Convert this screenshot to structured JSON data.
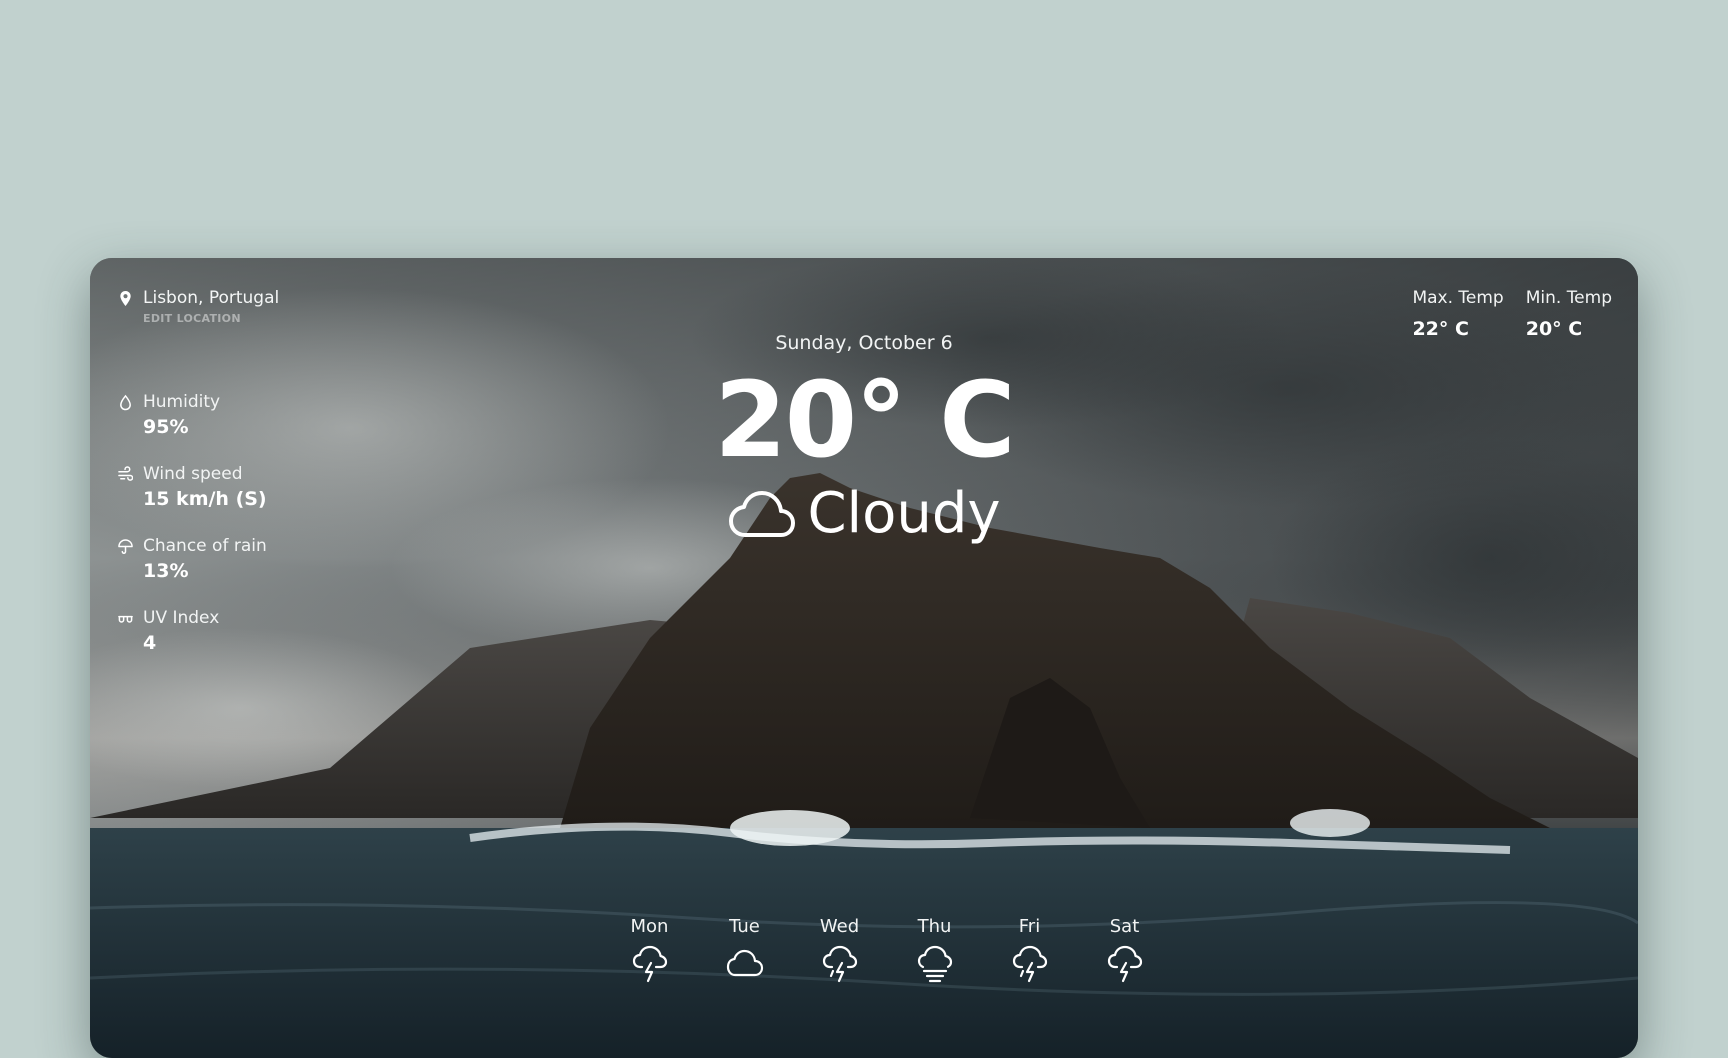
{
  "location": {
    "name": "Lisbon, Portugal",
    "edit_label": "EDIT LOCATION"
  },
  "stats": [
    {
      "icon": "droplet-icon",
      "label": "Humidity",
      "value": "95%"
    },
    {
      "icon": "wind-icon",
      "label": "Wind speed",
      "value": "15 km/h (S)"
    },
    {
      "icon": "umbrella-icon",
      "label": "Chance of rain",
      "value": "13%"
    },
    {
      "icon": "sunglasses-icon",
      "label": "UV Index",
      "value": "4"
    }
  ],
  "current": {
    "date": "Sunday, October 6",
    "temperature": "20° C",
    "condition": "Cloudy",
    "condition_icon": "cloud-icon"
  },
  "range": {
    "max_label": "Max. Temp",
    "max_value": "22° C",
    "min_label": "Min. Temp",
    "min_value": "20° C"
  },
  "forecast": [
    {
      "day": "Mon",
      "icon": "thunderstorm-icon"
    },
    {
      "day": "Tue",
      "icon": "cloud-icon"
    },
    {
      "day": "Wed",
      "icon": "rain-storm-icon"
    },
    {
      "day": "Thu",
      "icon": "fog-icon"
    },
    {
      "day": "Fri",
      "icon": "rain-storm-icon"
    },
    {
      "day": "Sat",
      "icon": "thunderstorm-icon"
    }
  ],
  "colors": {
    "page_background": "#c1d1ce",
    "text": "#ffffff"
  }
}
